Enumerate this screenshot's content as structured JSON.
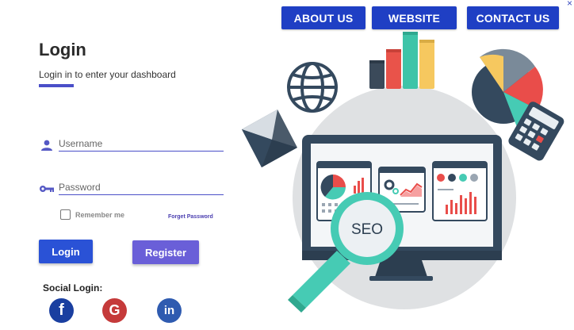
{
  "window": {
    "close_label": "×"
  },
  "nav": {
    "about": "ABOUT US",
    "website": "WEBSITE",
    "contact": "CONTACT US"
  },
  "login": {
    "title": "Login",
    "subtitle": "Login in to enter your dashboard",
    "username_placeholder": "Username",
    "password_placeholder": "Password",
    "remember_label": "Remember me",
    "forgot_label": "Forget Password",
    "login_button": "Login",
    "register_button": "Register"
  },
  "social": {
    "title": "Social Login:",
    "facebook_glyph": "f",
    "google_glyph": "G",
    "linkedin_glyph": "in"
  },
  "illustration": {
    "badge_text": "SEO"
  },
  "colors": {
    "nav_blue": "#1f3fc4",
    "accent": "#4a4fc8",
    "login_blue": "#2a52d6",
    "register_purple": "#6a5fd8"
  }
}
